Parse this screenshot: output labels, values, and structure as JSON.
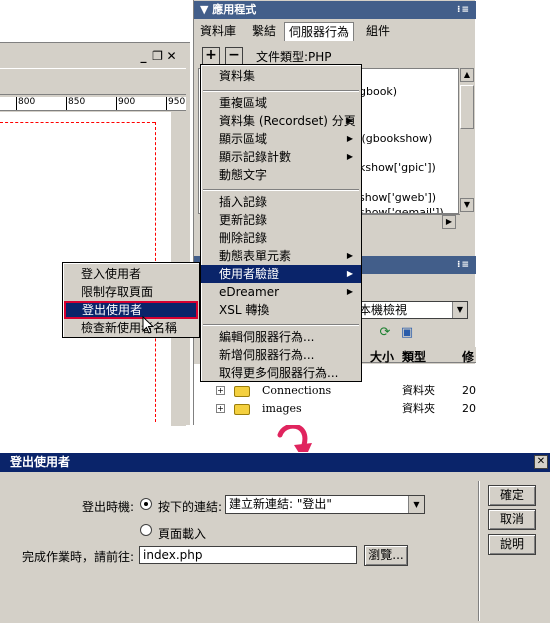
{
  "document_window": {
    "controls": [
      "_",
      "❐",
      "✕"
    ],
    "ruler_labels": [
      "800",
      "850",
      "900",
      "950"
    ]
  },
  "panel": {
    "app_title": "應用程式",
    "tabs": [
      {
        "label": "資料庫",
        "active": false
      },
      {
        "label": "繫結",
        "active": false
      },
      {
        "label": "伺服器行為",
        "active": true
      },
      {
        "label": "組件",
        "active": false
      }
    ],
    "add_label": "+",
    "remove_label": "−",
    "doc_type": "文件類型:PHP",
    "bindings": [
      "gbook)",
      "示 (gbookshow)",
      "kshow['gpic'])",
      "show['gweb'])",
      "show['gemail'])"
    ],
    "file_panel": {
      "view": "本機檢視",
      "columns": [
        "大小",
        "類型",
        "修"
      ],
      "rows": [
        {
          "name": "Connections",
          "kind": "資料夾",
          "date": "20"
        },
        {
          "name": "images",
          "kind": "資料夾",
          "date": "20"
        }
      ]
    }
  },
  "main_menu": {
    "items": [
      {
        "label": "資料集",
        "submenu": false,
        "selected": false
      },
      {
        "label": "重複區域",
        "submenu": false,
        "selected": false
      },
      {
        "label": "資料集 (Recordset) 分頁",
        "submenu": true,
        "selected": false
      },
      {
        "label": "顯示區域",
        "submenu": true,
        "selected": false
      },
      {
        "label": "顯示記錄計數",
        "submenu": true,
        "selected": false
      },
      {
        "label": "動態文字",
        "submenu": false,
        "selected": false
      },
      {
        "label": "插入記錄",
        "submenu": false,
        "selected": false
      },
      {
        "label": "更新記錄",
        "submenu": false,
        "selected": false
      },
      {
        "label": "刪除記錄",
        "submenu": false,
        "selected": false
      },
      {
        "label": "動態表單元素",
        "submenu": true,
        "selected": false
      },
      {
        "label": "使用者驗證",
        "submenu": true,
        "selected": true
      },
      {
        "label": "eDreamer",
        "submenu": true,
        "selected": false
      },
      {
        "label": "XSL 轉換",
        "submenu": false,
        "selected": false
      },
      {
        "label": "編輯伺服器行為...",
        "submenu": false,
        "selected": false
      },
      {
        "label": "新增伺服器行為...",
        "submenu": false,
        "selected": false
      },
      {
        "label": "取得更多伺服器行為...",
        "submenu": false,
        "selected": false
      }
    ]
  },
  "sub_menu": {
    "items": [
      {
        "label": "登入使用者",
        "selected": false
      },
      {
        "label": "限制存取頁面",
        "selected": false
      },
      {
        "label": "登出使用者",
        "selected": true
      },
      {
        "label": "檢查新使用者名稱",
        "selected": false
      }
    ]
  },
  "dialog": {
    "title": "登出使用者",
    "close_label": "✕",
    "logout_when_label": "登出時機:",
    "option_link_label": "按下的連結:",
    "option_link_selected": true,
    "link_select_value": "建立新連結: \"登出\"",
    "option_page_load_label": "頁面載入",
    "option_page_load_selected": false,
    "goto_label": "完成作業時，請前往:",
    "goto_value": "index.php",
    "browse_label": "瀏覽...",
    "ok_label": "確定",
    "cancel_label": "取消",
    "help_label": "說明"
  },
  "colors": {
    "highlight": "#0a246a",
    "panel_header": "#425e8a",
    "selection_outline": "#d70030",
    "arrow": "#e0245e"
  }
}
